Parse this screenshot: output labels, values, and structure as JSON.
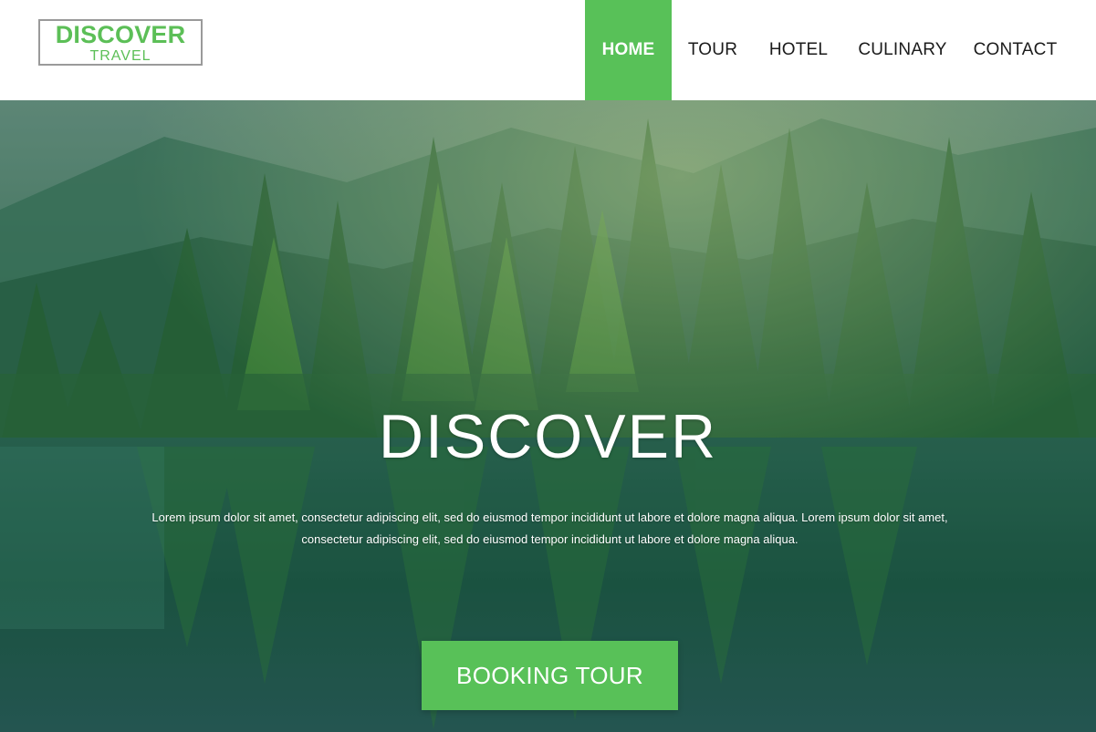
{
  "logo": {
    "title": "DISCOVER",
    "subtitle": "TRAVEL"
  },
  "nav": {
    "items": [
      {
        "label": "HOME",
        "active": true
      },
      {
        "label": "TOUR",
        "active": false
      },
      {
        "label": "HOTEL",
        "active": false
      },
      {
        "label": "CULINARY",
        "active": false
      },
      {
        "label": "CONTACT",
        "active": false
      }
    ]
  },
  "hero": {
    "title": "DISCOVER",
    "description": "Lorem ipsum dolor sit amet, consectetur adipiscing elit, sed do eiusmod tempor incididunt ut labore et dolore magna aliqua. Lorem ipsum dolor sit amet, consectetur adipiscing elit, sed do eiusmod tempor incididunt ut labore et dolore magna aliqua.",
    "button_label": "BOOKING TOUR",
    "background_icon": "forest-lake-photo"
  },
  "colors": {
    "accent": "#58c158",
    "logo_text": "#5cbf57",
    "logo_border": "#9a9a9a",
    "nav_text": "#1b1b1b",
    "hero_text": "#ffffff"
  }
}
